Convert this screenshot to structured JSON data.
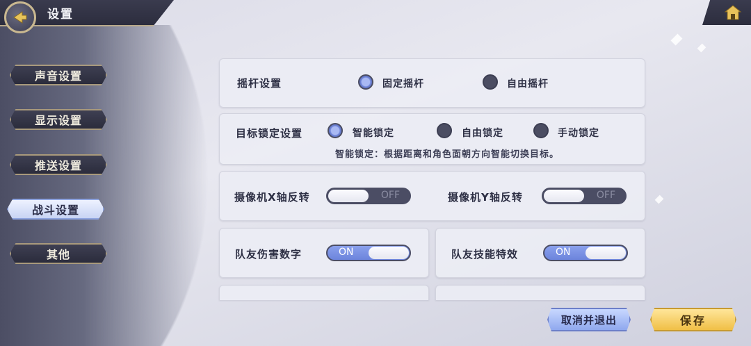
{
  "header": {
    "title": "设置"
  },
  "sidebar": {
    "items": [
      {
        "label": "声音设置",
        "active": false
      },
      {
        "label": "显示设置",
        "active": false
      },
      {
        "label": "推送设置",
        "active": false
      },
      {
        "label": "战斗设置",
        "active": true
      },
      {
        "label": "其他",
        "active": false
      }
    ]
  },
  "joystick": {
    "label": "摇杆设置",
    "options": [
      {
        "label": "固定摇杆",
        "selected": true
      },
      {
        "label": "自由摇杆",
        "selected": false
      }
    ]
  },
  "target_lock": {
    "label": "目标锁定设置",
    "options": [
      {
        "label": "智能锁定",
        "selected": true
      },
      {
        "label": "自由锁定",
        "selected": false
      },
      {
        "label": "手动锁定",
        "selected": false
      }
    ],
    "hint": "智能锁定：根据距离和角色面朝方向智能切换目标。"
  },
  "camera": {
    "x_label": "摄像机X轴反转",
    "x_state": "OFF",
    "y_label": "摄像机Y轴反转",
    "y_state": "OFF"
  },
  "teammate": {
    "damage_label": "队友伤害数字",
    "damage_state": "ON",
    "skill_label": "队友技能特效",
    "skill_state": "ON"
  },
  "footer": {
    "cancel_label": "取消并退出",
    "save_label": "保存"
  },
  "colors": {
    "accent_blue": "#7f95e4",
    "toggle_dark": "#4b4d64",
    "save_gold": "#f0bf46",
    "panel_bg": "#ecedf4"
  },
  "icons": {
    "back": "back-arrow-icon",
    "home": "home-icon"
  }
}
